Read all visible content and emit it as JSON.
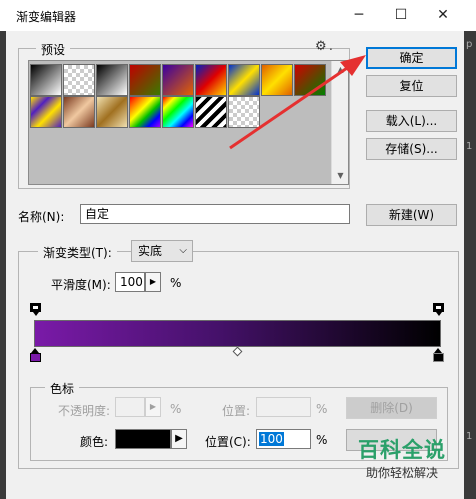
{
  "window": {
    "title": "渐变编辑器",
    "minimize": "─",
    "maximize": "☐",
    "close": "✕"
  },
  "presets": {
    "legend": "预设",
    "gear": "⚙",
    "gear_caret": ".",
    "swatches_row1": [
      "linear-gradient(135deg,#000 0%,#fff 100%)",
      "repeating-conic-gradient(#ccc 0 25%,#fff 0 50%) 0 0/8px 8px",
      "linear-gradient(135deg,#000,#fff)",
      "linear-gradient(135deg,#c00000,#3a7a00)",
      "linear-gradient(135deg,#3a00a0,#e46400)",
      "linear-gradient(135deg,#0020c0,#e00000,#ffd800)",
      "linear-gradient(135deg,#0030d0,#ffe000,#0030d0)",
      "linear-gradient(135deg,#e06000,#ffe000,#e06000)",
      "linear-gradient(135deg,#d00000,#008000)"
    ],
    "swatches_row2": [
      "linear-gradient(135deg,#ffe000 0,#5020c0 30%,#ffe000 60%,#5020c0 100%)",
      "linear-gradient(135deg,#7a3a20,#f0c8a0,#7a3a20)",
      "linear-gradient(135deg,#f0e0b0,#a07020,#f0e0b0)",
      "linear-gradient(135deg,#ff0000,#ff8000,#ffff00,#00c000,#0000ff,#a000ff)",
      "linear-gradient(135deg,#ff0000,#ffff00,#00ff00,#00ffff,#0000ff,#ff00ff)",
      "repeating-linear-gradient(135deg,#000 0 4px,#fff 4px 8px)",
      "repeating-conic-gradient(#ccc 0 25%,#fff 0 50%) 0 0/8px 8px"
    ]
  },
  "buttons": {
    "ok": "确定",
    "reset": "复位",
    "load": "载入(L)...",
    "save": "存储(S)...",
    "new": "新建(W)"
  },
  "name": {
    "label": "名称(N):",
    "value": "自定"
  },
  "gradient": {
    "type_label": "渐变类型(T):",
    "type_value": "实底",
    "smoothness_label": "平滑度(M):",
    "smoothness_value": "100",
    "smoothness_unit": "%",
    "stop_start_color": "#7a1aa8",
    "stop_end_color": "#000000"
  },
  "color_stops": {
    "legend": "色标",
    "opacity_label": "不透明度:",
    "opacity_unit": "%",
    "opacity_position_label": "位置:",
    "opacity_position_unit": "%",
    "delete_button": "删除(D)",
    "color_label": "颜色:",
    "color_value": "#000000",
    "color_position_label": "位置(C):",
    "color_position_value": "100",
    "color_position_unit": "%"
  },
  "watermark": {
    "title": "百科全说",
    "subtitle": "助你轻松解决"
  },
  "background": {
    "right_marks": [
      "p",
      "1",
      "1"
    ]
  }
}
